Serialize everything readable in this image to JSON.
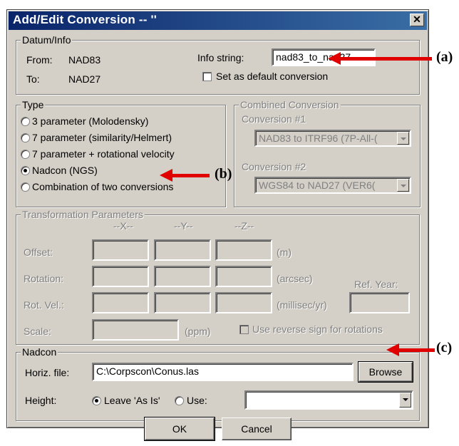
{
  "window": {
    "title": "Add/Edit Conversion -- ''"
  },
  "datum": {
    "legend": "Datum/Info",
    "from_label": "From:",
    "from_value": "NAD83",
    "to_label": "To:",
    "to_value": "NAD27",
    "info_label": "Info string:",
    "info_value": "nad83_to_nad27",
    "default_label": "Set as default conversion"
  },
  "type": {
    "legend": "Type",
    "options": [
      "3 parameter (Molodensky)",
      "7 parameter (similarity/Helmert)",
      "7 parameter + rotational velocity",
      "Nadcon (NGS)",
      "Combination of two conversions"
    ],
    "selected": "Nadcon (NGS)"
  },
  "combined": {
    "legend": "Combined Conversion",
    "conv1_label": "Conversion #1",
    "conv1_value": "NAD83 to ITRF96 (7P-All-(",
    "conv2_label": "Conversion #2",
    "conv2_value": "WGS84 to NAD27 (VER6("
  },
  "transform": {
    "legend": "Transformation Parameters",
    "col_x": "--X--",
    "col_y": "--Y--",
    "col_z": "--Z--",
    "offset_label": "Offset:",
    "offset_unit": "(m)",
    "rotation_label": "Rotation:",
    "rotation_unit": "(arcsec)",
    "rotvel_label": "Rot. Vel.:",
    "rotvel_unit": "(millisec/yr)",
    "refyear_label": "Ref. Year:",
    "scale_label": "Scale:",
    "scale_unit": "(ppm)",
    "reverse_label": "Use reverse sign for rotations"
  },
  "nadcon": {
    "legend": "Nadcon",
    "horiz_label": "Horiz. file:",
    "horiz_value": "C:\\Corpscon\\Conus.las",
    "browse_label": "Browse",
    "height_label": "Height:",
    "leave_label": "Leave 'As Is'",
    "use_label": "Use:",
    "use_value": ""
  },
  "buttons": {
    "ok": "OK",
    "cancel": "Cancel"
  },
  "annotations": {
    "a": "(a)",
    "b": "(b)",
    "c": "(c)"
  },
  "colors": {
    "title_bar": "#0a246a",
    "dialog": "#d4d0c8",
    "annotation_arrow": "#e00000"
  }
}
